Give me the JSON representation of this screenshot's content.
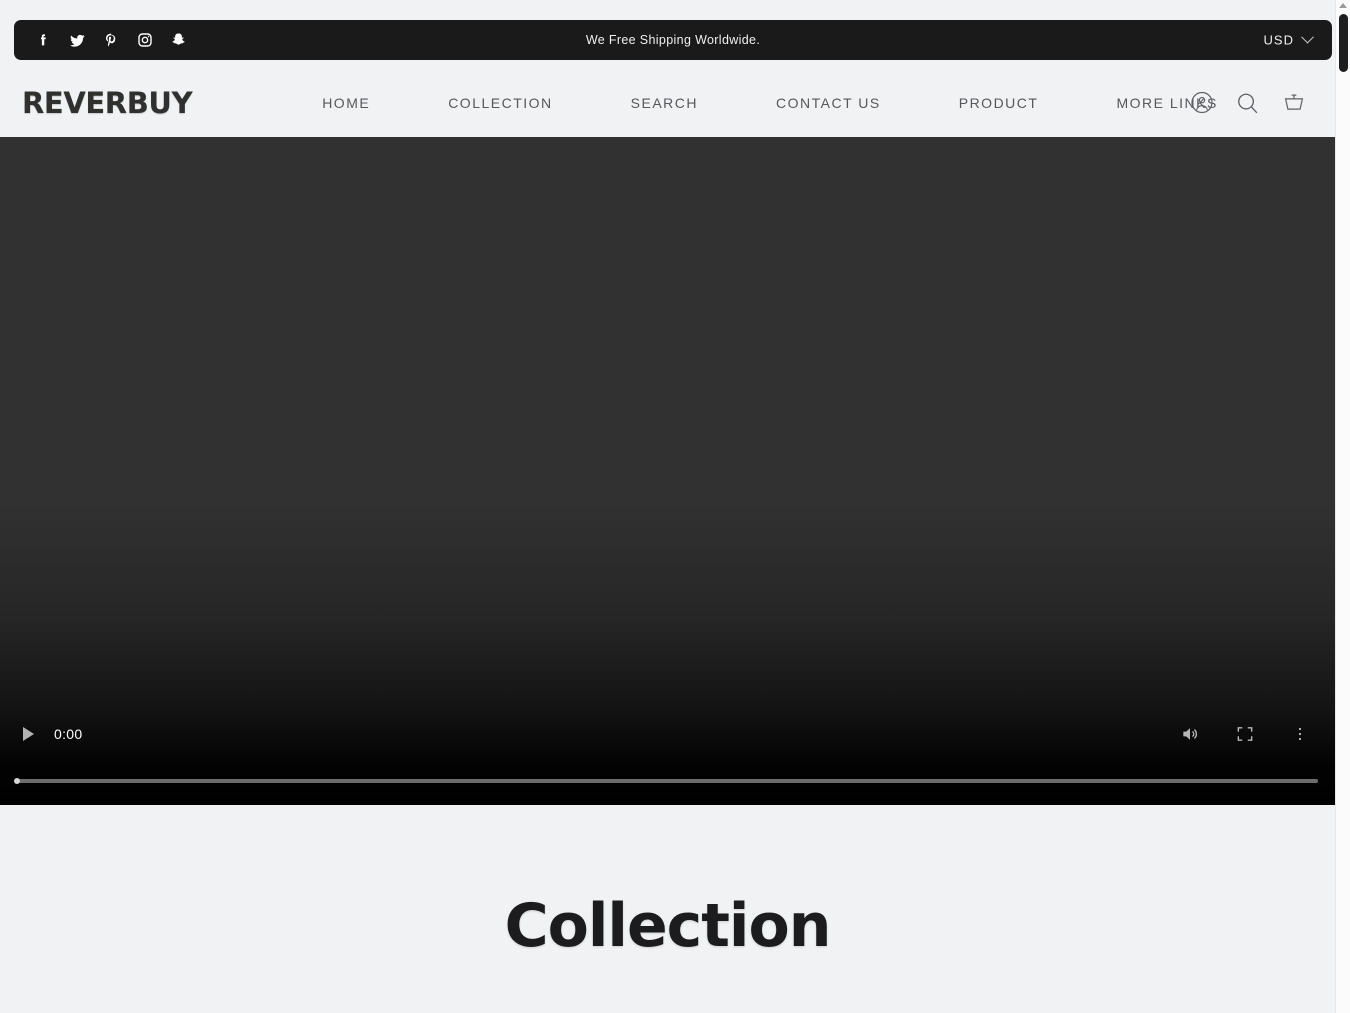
{
  "announcement": {
    "text": "We Free Shipping Worldwide.",
    "social": [
      {
        "name": "facebook",
        "label": "Facebook"
      },
      {
        "name": "twitter",
        "label": "Twitter"
      },
      {
        "name": "pinterest",
        "label": "Pinterest"
      },
      {
        "name": "instagram",
        "label": "Instagram"
      },
      {
        "name": "snapchat",
        "label": "Snapchat"
      }
    ],
    "currency": "USD",
    "currency_caret": "chevron-down-icon",
    "background": "#1a1a1a",
    "text_color": "#efefef"
  },
  "header": {
    "logo": "REVERBUY",
    "nav": [
      {
        "label": "HOME"
      },
      {
        "label": "COLLECTION"
      },
      {
        "label": "SEARCH"
      },
      {
        "label": "CONTACT US"
      },
      {
        "label": "PRODUCT"
      },
      {
        "label": "MORE LINKS"
      }
    ],
    "icons": [
      {
        "name": "account-icon",
        "label": "Account"
      },
      {
        "name": "search-icon",
        "label": "Search"
      },
      {
        "name": "cart-icon",
        "label": "Cart"
      }
    ],
    "background": "#f1f2f4",
    "nav_color": "#55585c",
    "logo_color": "#30302f"
  },
  "hero_video": {
    "current_time": "0:00",
    "play_state": "paused",
    "progress_percent": 0,
    "controls": [
      {
        "name": "play-button",
        "label": "Play"
      },
      {
        "name": "mute-button",
        "label": "Mute"
      },
      {
        "name": "fullscreen-button",
        "label": "Enter full screen"
      },
      {
        "name": "more-options-button",
        "label": "More options"
      }
    ],
    "background_top": "#313131",
    "background_bottom": "#000000"
  },
  "collection": {
    "title": "Collection",
    "background": "#f1f2f4",
    "title_color": "#1c1c1e"
  },
  "browser": {
    "scrollbar": {
      "thumb_color": "#1d1d1f",
      "track_color": "#fbfbfc"
    }
  }
}
